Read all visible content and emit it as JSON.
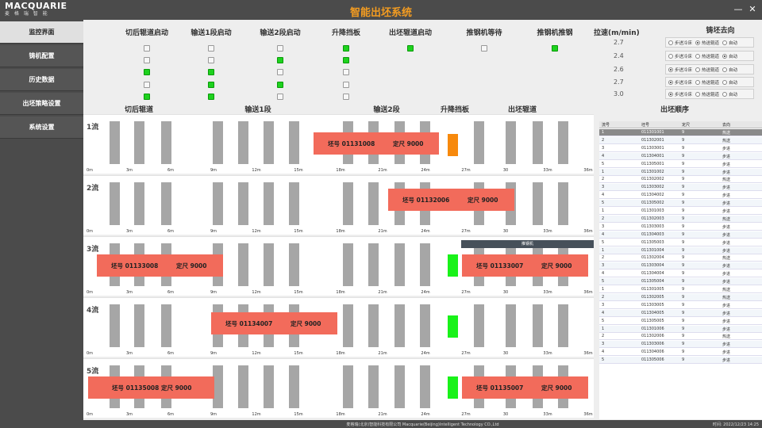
{
  "app": {
    "logo_text": "MACQUARIE",
    "logo_sub": "麦 格 瑞 智 能",
    "title": "智能出坯系统",
    "window_buttons": {
      "minimize": "—",
      "close": "✕"
    }
  },
  "sidebar": {
    "items": [
      {
        "label": "监控界面",
        "active": true
      },
      {
        "label": "铸机配置",
        "active": false
      },
      {
        "label": "历史数据",
        "active": false
      },
      {
        "label": "出坯策略设置",
        "active": false
      },
      {
        "label": "系统设置",
        "active": false
      }
    ]
  },
  "controls": {
    "columns": [
      {
        "label": "切后辊道启动",
        "states": [
          false,
          false,
          true,
          false,
          true
        ]
      },
      {
        "label": "输送1段启动",
        "states": [
          false,
          false,
          true,
          true,
          true
        ]
      },
      {
        "label": "输送2段启动",
        "states": [
          false,
          true,
          false,
          true,
          false
        ]
      },
      {
        "label": "升降挡板",
        "states": [
          true,
          true,
          false,
          false,
          false
        ]
      },
      {
        "label": "出坯辊道启动",
        "states": [
          true
        ]
      },
      {
        "label": "推钢机等待",
        "states": [
          false
        ]
      },
      {
        "label": "推钢机推钢",
        "states": [
          true
        ]
      }
    ],
    "speed_label": "拉速(m/min)",
    "speeds": [
      "2.7",
      "2.4",
      "2.6",
      "2.7",
      "3.0"
    ],
    "direction_label": "铸坯去向",
    "direction_options": [
      "步进冷床",
      "热送辊道",
      "自动"
    ],
    "direction_selected": [
      1,
      2,
      0,
      0,
      0
    ]
  },
  "sections": {
    "cut_roller": "切后辊道",
    "conveyor1": "输送1段",
    "conveyor2": "输送2段",
    "lifter": "升降挡板",
    "exit_roller": "出坯辊道",
    "order": "出坯顺序"
  },
  "ticks": [
    "0m",
    "3m",
    "6m",
    "9m",
    "12m",
    "15m",
    "18m",
    "21m",
    "24m",
    "27m",
    "30",
    "33m",
    "36m"
  ],
  "flows": [
    {
      "label": "1流",
      "stop_color": "#f7890c",
      "slabs": [
        {
          "id": "坯号 01131008",
          "len": "定尺 9000"
        }
      ]
    },
    {
      "label": "2流",
      "stop_color": null,
      "slabs": [
        {
          "id": "坯号 01132006",
          "len": "定尺 9000"
        }
      ]
    },
    {
      "label": "3流",
      "stop_color": "#19f219",
      "slabs": [
        {
          "id": "坯号 01133008",
          "len": "定尺 9000"
        },
        {
          "id": "坯号 01133007",
          "len": "定尺 9000"
        }
      ]
    },
    {
      "label": "4流",
      "stop_color": "#19f219",
      "slabs": [
        {
          "id": "坯号 01134007",
          "len": "定尺 9000"
        }
      ]
    },
    {
      "label": "5流",
      "stop_color": "#19f219",
      "slabs": [
        {
          "id": "坯号 01135008 定尺 9000",
          "len": ""
        },
        {
          "id": "坯号 01135007",
          "len": "定尺 9000"
        }
      ]
    }
  ],
  "pusher_label": "推钢机",
  "order_table": {
    "headers": [
      "流号",
      "坯号",
      "定尺",
      "去向"
    ],
    "rows": [
      [
        "1",
        "011301001",
        "9",
        "热送"
      ],
      [
        "2",
        "011302001",
        "9",
        "热送"
      ],
      [
        "3",
        "011303001",
        "9",
        "步进"
      ],
      [
        "4",
        "011304001",
        "9",
        "步进"
      ],
      [
        "5",
        "011305001",
        "9",
        "步进"
      ],
      [
        "1",
        "011301002",
        "9",
        "步进"
      ],
      [
        "2",
        "011302002",
        "9",
        "热送"
      ],
      [
        "3",
        "011303002",
        "9",
        "步进"
      ],
      [
        "4",
        "011304002",
        "9",
        "步进"
      ],
      [
        "5",
        "011305002",
        "9",
        "步进"
      ],
      [
        "1",
        "011301003",
        "9",
        "步进"
      ],
      [
        "2",
        "011302003",
        "9",
        "热送"
      ],
      [
        "3",
        "011303003",
        "9",
        "步进"
      ],
      [
        "4",
        "011304003",
        "9",
        "步进"
      ],
      [
        "5",
        "011305003",
        "9",
        "步进"
      ],
      [
        "1",
        "011301004",
        "9",
        "步进"
      ],
      [
        "2",
        "011302004",
        "9",
        "热送"
      ],
      [
        "3",
        "011303004",
        "9",
        "步进"
      ],
      [
        "4",
        "011304004",
        "9",
        "步进"
      ],
      [
        "5",
        "011305004",
        "9",
        "步进"
      ],
      [
        "1",
        "011301005",
        "9",
        "热送"
      ],
      [
        "2",
        "011302005",
        "9",
        "热送"
      ],
      [
        "3",
        "011303005",
        "9",
        "步进"
      ],
      [
        "4",
        "011304005",
        "9",
        "步进"
      ],
      [
        "5",
        "011305005",
        "9",
        "步进"
      ],
      [
        "1",
        "011301006",
        "9",
        "步进"
      ],
      [
        "2",
        "011302006",
        "9",
        "热送"
      ],
      [
        "3",
        "011303006",
        "9",
        "步进"
      ],
      [
        "4",
        "011304006",
        "9",
        "步进"
      ],
      [
        "5",
        "011305006",
        "9",
        "步进"
      ]
    ],
    "selected_row": 0
  },
  "status": {
    "company": "麦格瑞(北京)智能科技有限公司  Macquarie(Beijing)Intelligent Technology CO.,Ltd",
    "time": "时间: 2022/12/23  14:25"
  }
}
